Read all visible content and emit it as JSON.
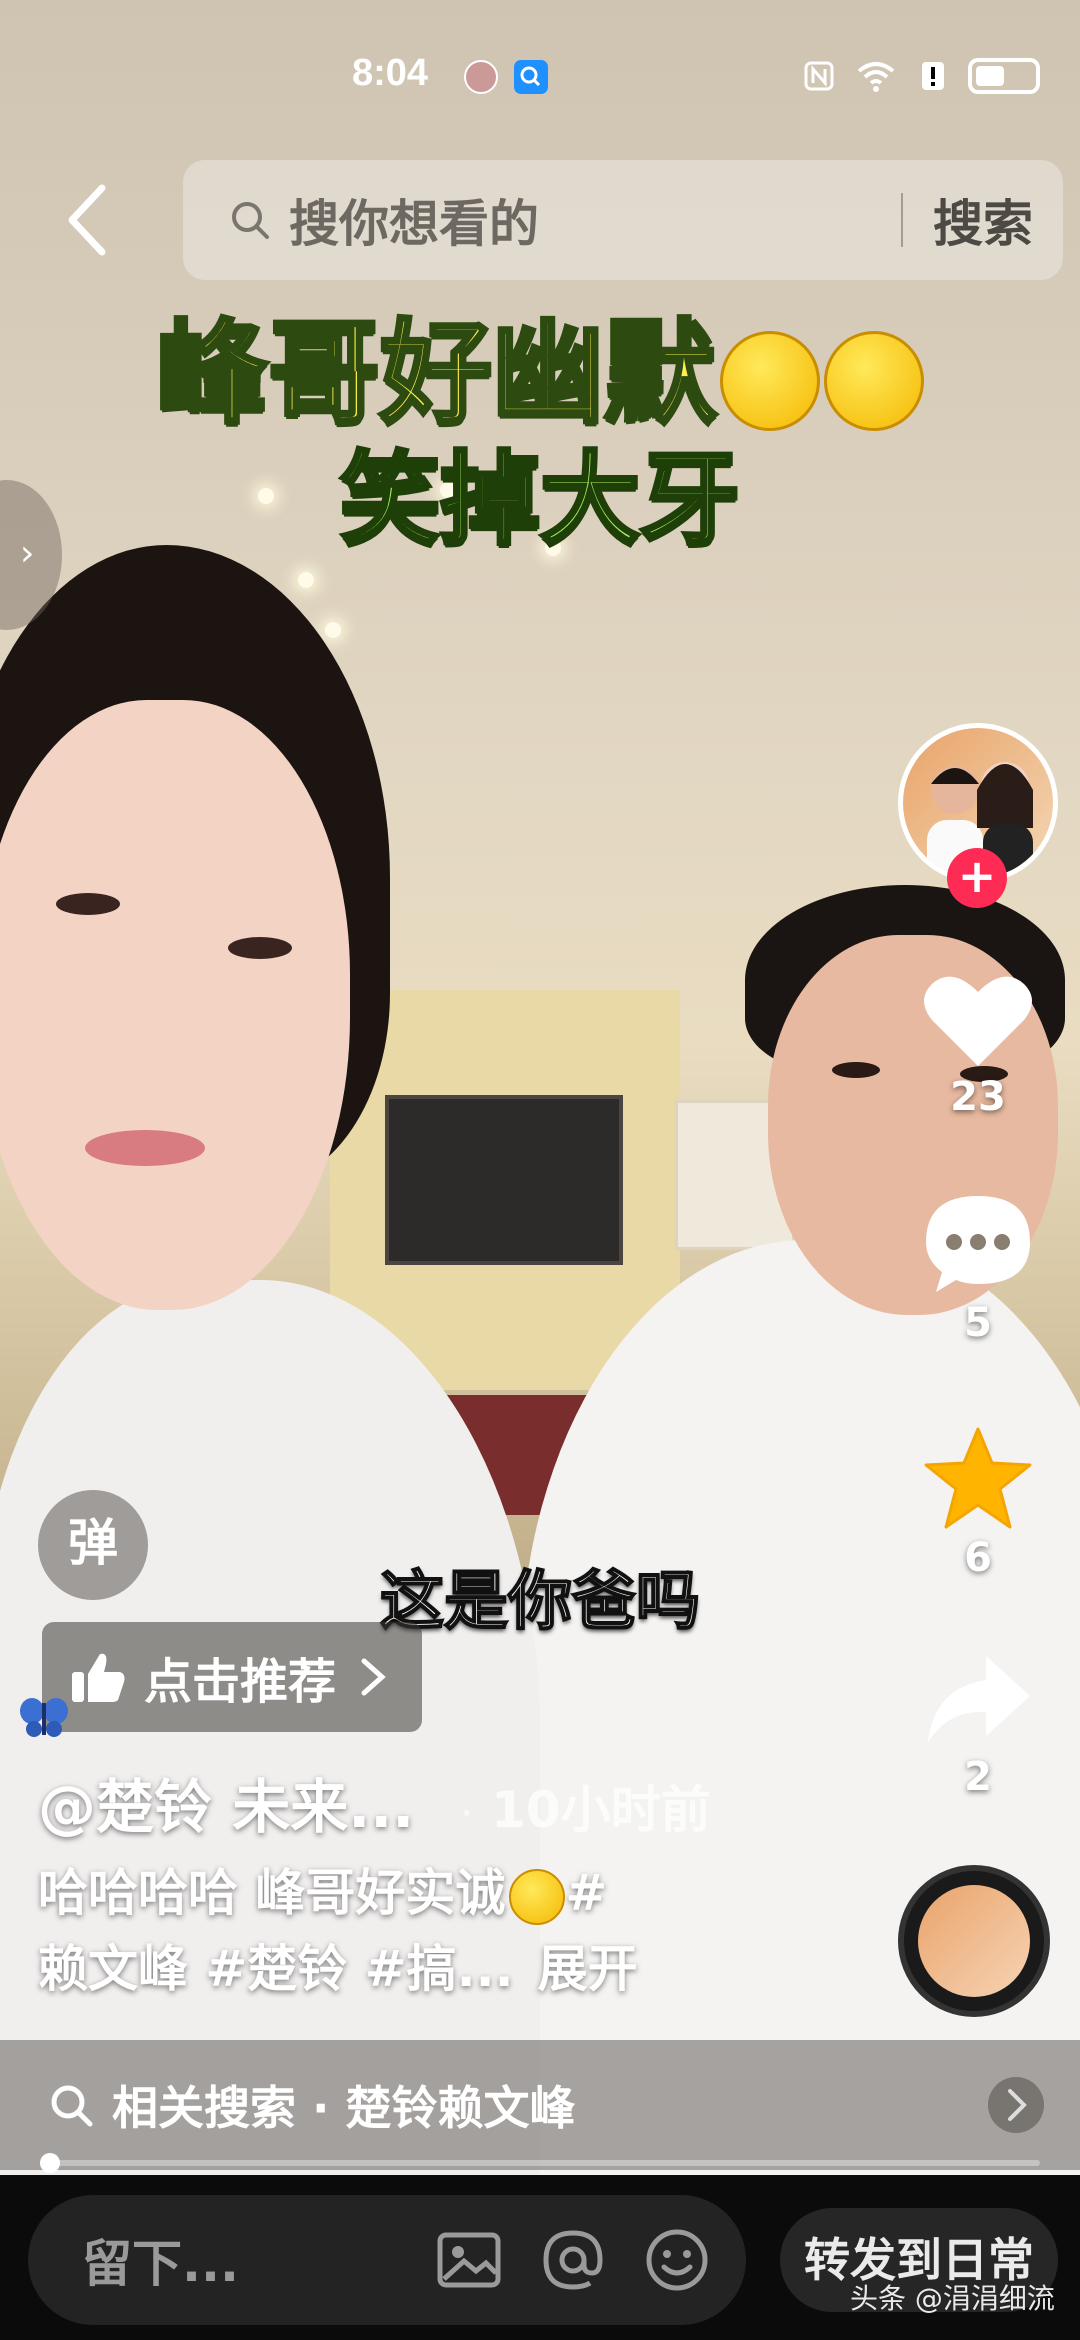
{
  "status_bar": {
    "time": "8:04"
  },
  "search": {
    "placeholder": "搜你想看的",
    "button_label": "搜索"
  },
  "video": {
    "overlay_title_line1": "峰哥好幽默",
    "overlay_title_line2": "笑掉大牙",
    "subtitle": "这是你爸吗",
    "danmaku_label": "弹"
  },
  "actions": {
    "likes": "23",
    "comments": "5",
    "favorites": "6",
    "shares": "2"
  },
  "recommend": {
    "label": "点击推荐"
  },
  "post": {
    "author": "@楚铃 未来...",
    "time": "10小时前",
    "description_line1": "哈哈哈哈 峰哥好实诚",
    "description_line1_tail": "#",
    "description_line2": "赖文峰 #楚铃 #搞...",
    "expand_label": "展开"
  },
  "related_search": {
    "label": "相关搜索 · 楚铃赖文峰"
  },
  "playback": {
    "progress": 0.01
  },
  "bottom_bar": {
    "comment_placeholder": "留下...",
    "repost_label": "转发到日常"
  },
  "watermark": "头条 @涓涓细流",
  "colors": {
    "follow": "#fe2c55",
    "favorite_star": "#ffb400",
    "title_yellow": "#fff14a",
    "title_green": "#a7f25a"
  }
}
